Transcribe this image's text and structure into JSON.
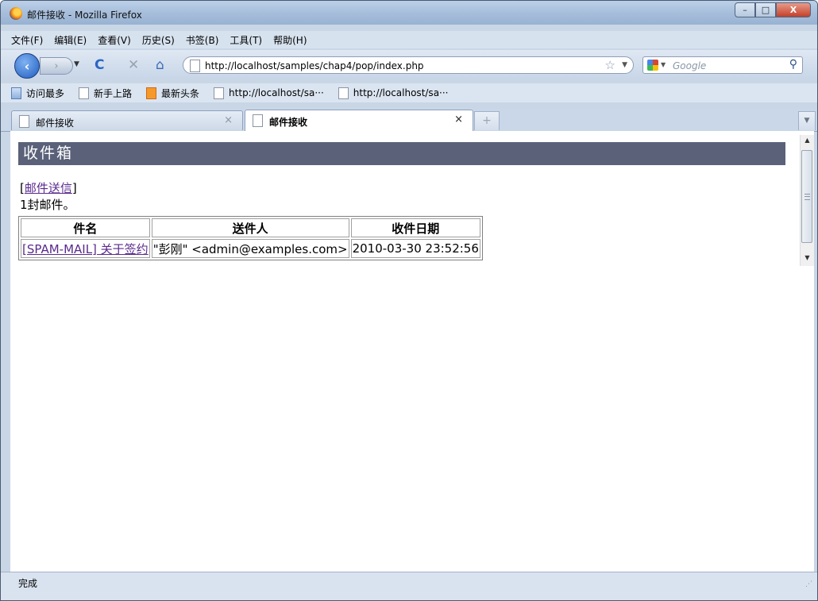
{
  "window": {
    "title": "邮件接收 - Mozilla Firefox",
    "buttons": {
      "minimize": "–",
      "maximize": "□",
      "close": "X"
    }
  },
  "menubar": {
    "items": [
      "文件(F)",
      "编辑(E)",
      "查看(V)",
      "历史(S)",
      "书签(B)",
      "工具(T)",
      "帮助(H)"
    ]
  },
  "navbar": {
    "url": "http://localhost/samples/chap4/pop/index.php",
    "search_placeholder": "Google",
    "icons": {
      "back": "‹",
      "forward": "›",
      "reload": "C",
      "stop": "✕",
      "home": "⌂",
      "star": "☆",
      "search": "⚲"
    }
  },
  "bookmarks": {
    "items": [
      {
        "label": "访问最多",
        "icon": "smart"
      },
      {
        "label": "新手上路",
        "icon": "page"
      },
      {
        "label": "最新头条",
        "icon": "rss"
      },
      {
        "label": "http://localhost/sa···",
        "icon": "page"
      },
      {
        "label": "http://localhost/sa···",
        "icon": "page"
      }
    ]
  },
  "tabs": [
    {
      "label": "邮件接收",
      "active": false
    },
    {
      "label": "邮件接收",
      "active": true
    }
  ],
  "tab_close": "×",
  "new_tab": "+",
  "page": {
    "heading": "收件箱",
    "send_link_prefix": "[",
    "send_link": "邮件送信",
    "send_link_suffix": "]",
    "mail_count": "1封邮件。",
    "table": {
      "headers": [
        "件名",
        "送件人",
        "收件日期"
      ],
      "rows": [
        [
          "[SPAM-MAIL] 关于签约",
          "\"彭刚\" <admin@examples.com>",
          "2010-03-30 23:52:56"
        ]
      ]
    }
  },
  "statusbar": {
    "text": "完成"
  },
  "colors": {
    "heading_bg": "#5a6179",
    "link": "#5a2a8c"
  }
}
